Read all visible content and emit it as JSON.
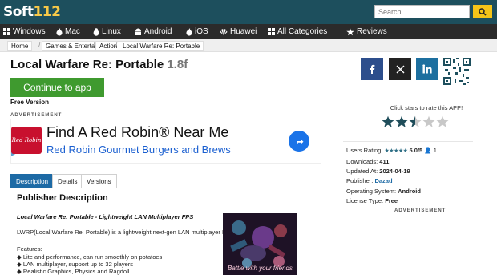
{
  "header": {
    "logo_main": "Soft",
    "logo_num": "112",
    "search_placeholder": "Search"
  },
  "nav": {
    "items": [
      {
        "label": "Windows",
        "icon": "windows-icon"
      },
      {
        "label": "Mac",
        "icon": "apple-icon"
      },
      {
        "label": "Linux",
        "icon": "linux-icon"
      },
      {
        "label": "Android",
        "icon": "android-icon"
      },
      {
        "label": "iOS",
        "icon": "apple-icon"
      },
      {
        "label": "Huawei",
        "icon": "huawei-icon"
      },
      {
        "label": "All Categories",
        "icon": "grid-icon"
      },
      {
        "label": "Reviews",
        "icon": "star-icon"
      }
    ]
  },
  "breadcrumb": [
    "Home",
    "Games & Entertainment",
    "Action",
    "Local Warfare Re: Portable"
  ],
  "app": {
    "title": "Local Warfare Re: Portable",
    "version": "1.8f",
    "cta_label": "Continue to app",
    "license_line": "Free Version"
  },
  "ad": {
    "label": "ADVERTISEMENT",
    "logo_text": "Red Robin",
    "headline": "Find A Red Robin® Near Me",
    "subline": "Red Robin Gourmet Burgers and Brews"
  },
  "tabs": [
    {
      "label": "Description",
      "active": true
    },
    {
      "label": "Details",
      "active": false
    },
    {
      "label": "Versions",
      "active": false
    }
  ],
  "description": {
    "heading": "Publisher Description",
    "lead": "Local Warfare Re: Portable - Lightweight LAN Multiplayer FPS",
    "paragraph": "LWRP(Local Warfare Re: Portable) is a lightweight next-gen LAN multiplayer FPS.",
    "features_heading": "Features:",
    "features": [
      "◆ Lite and performance, can run smoothly on potatoes",
      "◆ LAN multiplayer, support up to 32 players",
      "◆ Realistic Graphics, Physics and Ragdoll"
    ],
    "screenshot_caption": "Battle with your friends"
  },
  "sidebar": {
    "rate_prompt": "Click stars to rate this APP!",
    "rating_fraction": 0.5,
    "users_rating_label": "Users Rating:",
    "users_rating_value": "5.0/5",
    "users_rating_count": "1",
    "downloads_label": "Downloads:",
    "downloads_value": "411",
    "updated_label": "Updated At:",
    "updated_value": "2024-04-19",
    "publisher_label": "Publisher:",
    "publisher_value": "Dazad",
    "os_label": "Operating System:",
    "os_value": "Android",
    "license_label": "License Type:",
    "license_value": "Free",
    "ad_label": "ADVERTISEMENT"
  },
  "colors": {
    "header_bg": "#1d4f5d",
    "nav_bg": "#2b2b2b",
    "cta_green": "#3f9a2f",
    "tab_active": "#1d6aa5",
    "search_button": "#f5c518",
    "facebook": "#2d4e8c",
    "linkedin": "#1d6f9f"
  }
}
